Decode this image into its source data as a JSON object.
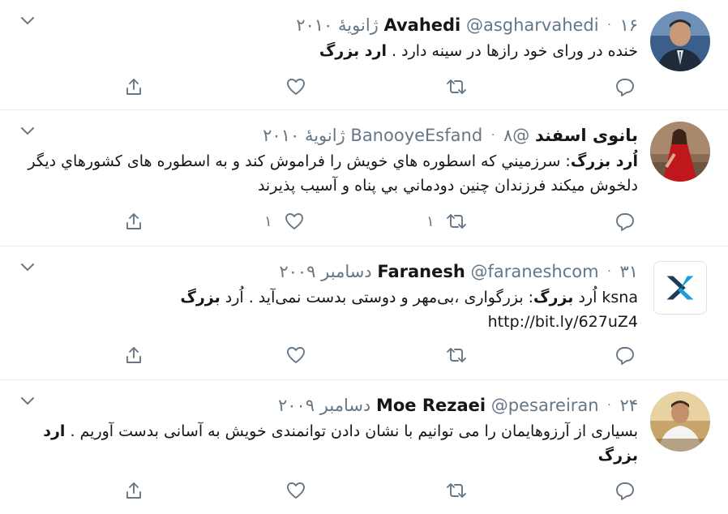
{
  "tweets": [
    {
      "name": "Avahedi",
      "handle": "@asgharvahedi",
      "date": "۱۶ ژانویهٔ ۲۰۱۰",
      "body_html_parts": [
        {
          "text": "خنده در ورای خود رازها در سینه دارد . ",
          "bold": false
        },
        {
          "text": "ارد بزرگ",
          "bold": true
        }
      ],
      "reply_count": "",
      "retweet_count": "",
      "like_count": "",
      "avatar": "man-in-suit-avatar"
    },
    {
      "name": "بانوی اسفند",
      "handle": "@BanooyeEsfand",
      "date": "۸ ژانویهٔ ۲۰۱۰",
      "body_html_parts": [
        {
          "text": "اُرد بزرگ",
          "bold": true
        },
        {
          "text": ": سرزميني كه اسطوره هاي خويش را فراموش كند و به اسطوره های كشورهاي ديگر دلخوش ميكند فرزندان چنين دودماني بي پناه و آسيب پذيرند",
          "bold": false
        }
      ],
      "reply_count": "",
      "retweet_count": "۱",
      "like_count": "۱",
      "avatar": "woman-in-red-avatar"
    },
    {
      "name": "Faranesh",
      "handle": "@faraneshcom",
      "date": "۳۱ دسامبر ۲۰۰۹",
      "body_html_parts": [
        {
          "text": "ksna اُرد ",
          "bold": false
        },
        {
          "text": "بزرگ",
          "bold": true
        },
        {
          "text": ": بزرگواری ،بی‌مهر و دوستی بدست نمی‌آید . اُرد ",
          "bold": false
        },
        {
          "text": "بزرگ",
          "bold": true
        },
        {
          "text": " http://bit.ly/627uZ4",
          "bold": false
        }
      ],
      "reply_count": "",
      "retweet_count": "",
      "like_count": "",
      "avatar": "faranesh-logo-avatar"
    },
    {
      "name": "Moe Rezaei",
      "handle": "@pesareiran",
      "date": "۲۴ دسامبر ۲۰۰۹",
      "body_html_parts": [
        {
          "text": "بسیاری از آرزوهایمان را می توانیم با نشان دادن توانمندی خویش به آسانی بدست آوریم . ",
          "bold": false
        },
        {
          "text": "ارد بزرگ",
          "bold": true
        }
      ],
      "reply_count": "",
      "retweet_count": "",
      "like_count": "",
      "avatar": "man-smiling-avatar"
    }
  ],
  "colors": {
    "text": "#14171a",
    "secondary": "#657786",
    "divider": "#e6ecf0"
  }
}
